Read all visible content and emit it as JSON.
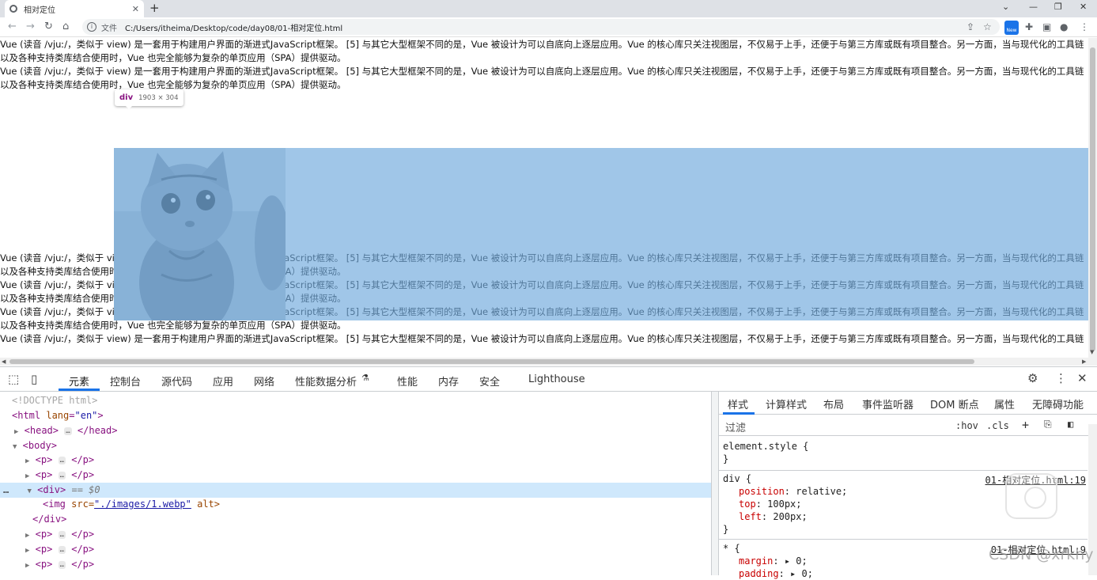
{
  "browser": {
    "tab_title": "相对定位",
    "new_tab": "+",
    "file_label": "文件",
    "url": "C:/Users/itheima/Desktop/code/day08/01-相对定位.html",
    "new_badge": "New"
  },
  "page": {
    "line1": "Vue (读音 /vjuː/，类似于 view) 是一套用于构建用户界面的渐进式JavaScript框架。 [5] 与其它大型框架不同的是，Vue 被设计为可以自底向上逐层应用。Vue 的核心库只关注视图层，不仅易于上手，还便于与第三方库或既有项目整合。另一方面，当与现代化的工具链",
    "line2": "以及各种支持类库结合使用时，Vue 也完全能够为复杂的单页应用（SPA）提供驱动。",
    "highlight_tooltip": {
      "tag": "div",
      "size": "1903 × 304"
    },
    "colors": {
      "highlight": "#6fa8dc"
    }
  },
  "devtools": {
    "tabs": [
      "元素",
      "控制台",
      "源代码",
      "应用",
      "网络",
      "性能数据分析",
      "性能",
      "内存",
      "安全",
      "Lighthouse"
    ],
    "elements": {
      "doctype": "<!DOCTYPE html>",
      "html_open": "<html",
      "lang_attr": "lang",
      "lang_value": "\"en\"",
      "head": "<head>",
      "head_close": "</head>",
      "body": "<body>",
      "p": "<p>",
      "p_close": "</p>",
      "div": "<div>",
      "eq": "== $0",
      "img": "<img",
      "src_attr": "src=",
      "src_value": "\"./images/1.webp\"",
      "alt_attr": "alt>",
      "div_close": "</div>",
      "ellipsis": "…",
      "dots": "…"
    },
    "styles": {
      "tabs": [
        "样式",
        "计算样式",
        "布局",
        "事件监听器",
        "DOM 断点",
        "属性",
        "无障碍功能"
      ],
      "filter_placeholder": "过滤",
      "hov": ":hov",
      ".cls": ".cls",
      "element_style": "element.style {",
      "close_brace": "}",
      "rule_selector": "div {",
      "rule_source": "01-相对定位.html:19",
      "decls": [
        {
          "prop": "position",
          "value": "relative;"
        },
        {
          "prop": "top",
          "value": "100px;"
        },
        {
          "prop": "left",
          "value": "200px;"
        }
      ],
      "star_selector": "* {",
      "star_source": "01-相对定位.html:9",
      "star_decls": [
        {
          "prop": "margin",
          "value": "▸ 0;"
        },
        {
          "prop": "padding",
          "value": "▸ 0;"
        }
      ]
    }
  },
  "watermark": "CSDN @xrkhy"
}
